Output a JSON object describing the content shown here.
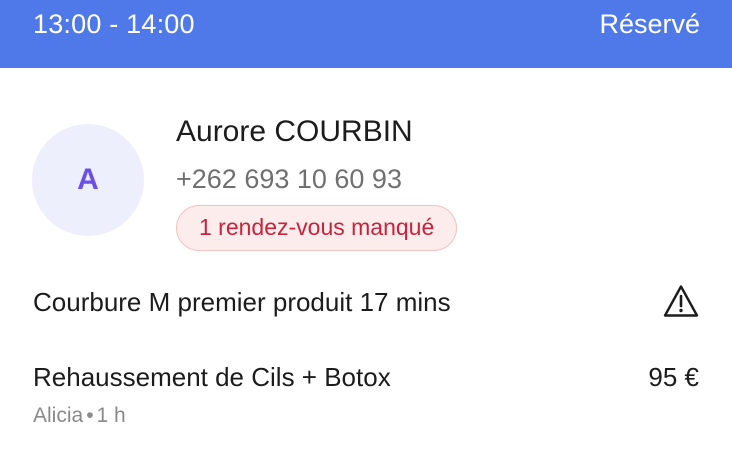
{
  "header": {
    "time_range": "13:00 - 14:00",
    "status": "Réservé",
    "color": "#4f79e8"
  },
  "client": {
    "avatar_initial": "A",
    "name": "Aurore COURBIN",
    "phone": "+262 693 10 60 93",
    "missed_badge": "1 rendez-vous manqué"
  },
  "note": {
    "text": "Courbure M premier produit 17 mins",
    "icon": "warning-triangle-icon"
  },
  "service": {
    "name": "Rehaussement de Cils + Botox",
    "price": "95 €",
    "staff": "Alicia",
    "separator": "•",
    "duration": "1 h"
  }
}
